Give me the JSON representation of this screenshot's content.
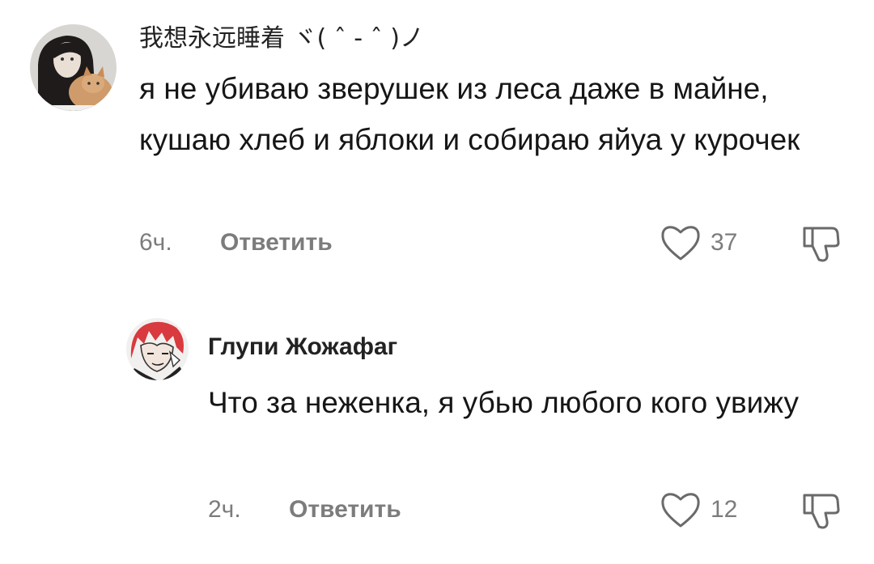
{
  "comments": [
    {
      "username": "我想永远睡着 ヾ( ˆ - ˆ )ノ",
      "text": "я не убиваю зверушек из леса даже в майне, кушаю хлеб и яблоки и собираю яйуа у курочек",
      "time": "6ч.",
      "reply_label": "Ответить",
      "likes": "37",
      "like_icon": "heart-outline",
      "dislike_icon": "thumbs-down-outline"
    },
    {
      "username": "Глупи Жожафаг",
      "text": "Что за неженка, я убью любого кого увижу",
      "time": "2ч.",
      "reply_label": "Ответить",
      "likes": "12",
      "like_icon": "heart-outline",
      "dislike_icon": "thumbs-down-outline"
    }
  ],
  "colors": {
    "text": "#161616",
    "secondary": "#7c7c7c",
    "background": "#ffffff"
  }
}
